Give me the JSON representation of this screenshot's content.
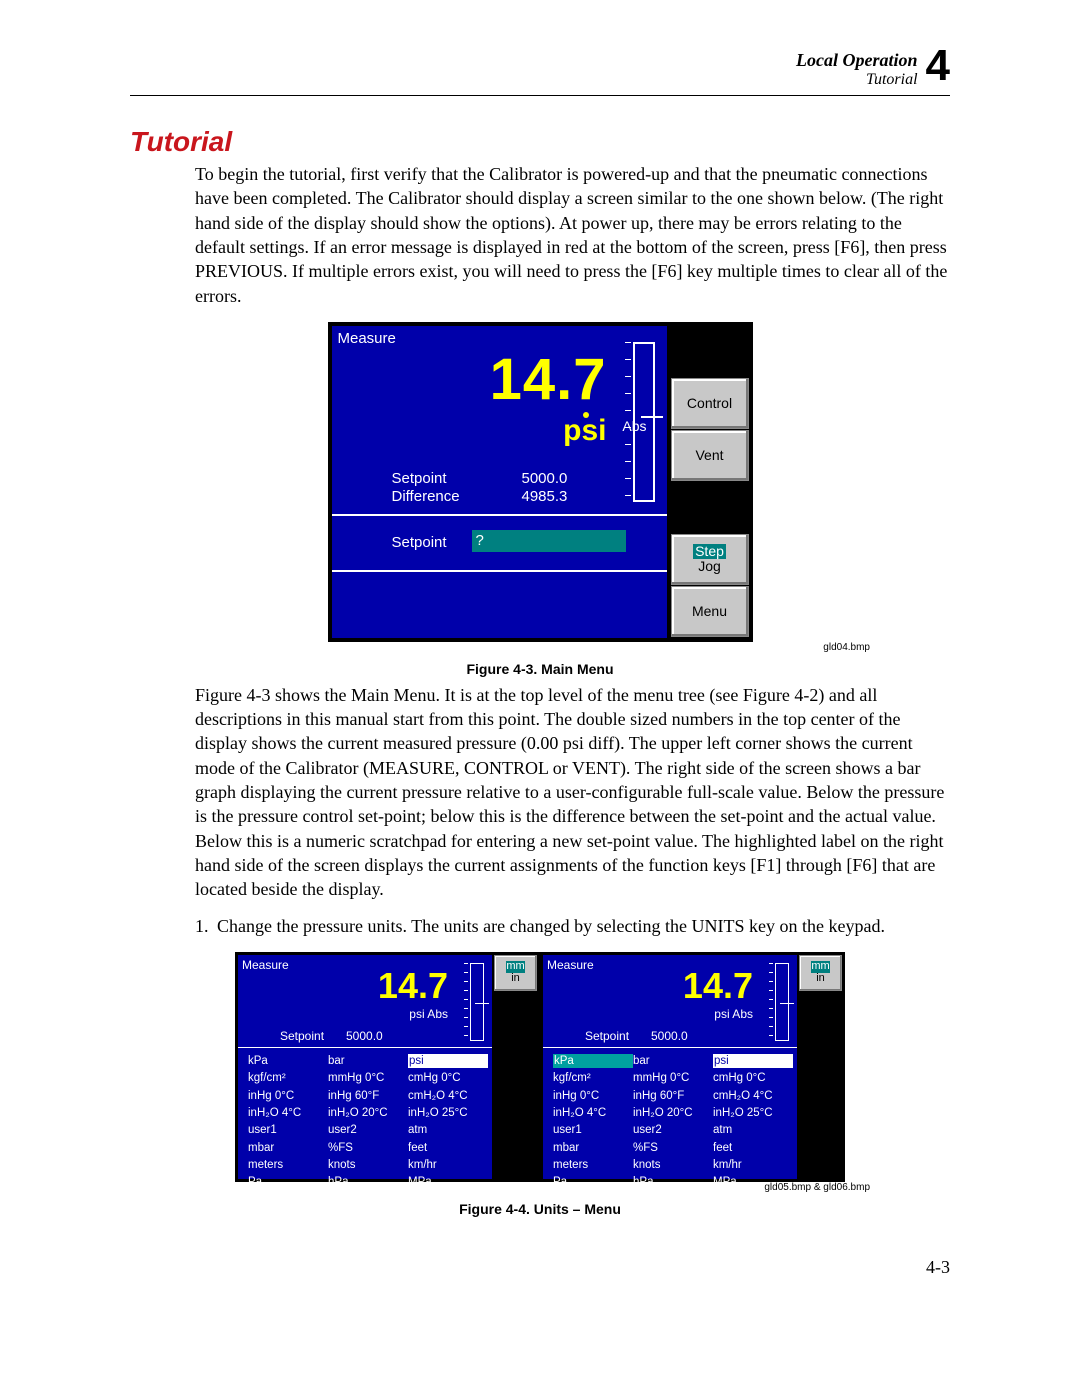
{
  "header": {
    "title": "Local Operation",
    "subtitle": "Tutorial",
    "chapter": "4"
  },
  "section_heading": "Tutorial",
  "para1": "To begin the tutorial, first verify that the Calibrator is powered-up and that the pneumatic connections have been completed. The Calibrator should display a screen similar to the one shown below. (The right hand side of the display should show the options). At power up, there may be errors relating to the default settings. If an error message is displayed in red at the bottom of the screen, press [F6], then press PREVIOUS. If multiple errors exist, you will need to press the [F6] key multiple times to clear all of the errors.",
  "fig43": {
    "mode": "Measure",
    "reading": "14.7",
    "unit": "psi",
    "abs": "Abs",
    "setpoint_label": "Setpoint",
    "difference_label": "Difference",
    "setpoint_value": "5000.0",
    "difference_value": "4985.3",
    "scratch_label": "Setpoint",
    "scratch_value": "?",
    "buttons": {
      "f2": "Control",
      "f3": "Vent",
      "f5_hi": "Step",
      "f5_lo": "Jog",
      "f6": "Menu"
    },
    "caption": "Figure 4-3. Main Menu",
    "imgid": "gld04.bmp"
  },
  "para2": "Figure 4-3 shows the Main Menu. It is at the top level of the menu tree (see Figure 4-2) and all descriptions in this manual start from this point. The double sized numbers in the top center of the display shows the current measured pressure (0.00 psi diff). The upper left corner shows the current mode of the Calibrator (MEASURE, CONTROL or VENT). The right side of the screen shows a bar graph displaying the current pressure relative to a user-configurable full-scale value. Below the pressure is the pressure control set-point; below this is the difference between the set-point and the actual value. Below this is a numeric scratchpad for entering a new set-point value. The highlighted label on the right hand side of the screen displays the current assignments of the function keys [F1] through [F6] that are located beside the display.",
  "step1": "Change the pressure units. The units are changed by selecting the UNITS key on the keypad.",
  "fig44": {
    "mode": "Measure",
    "reading": "14.7",
    "unit": "psi Abs",
    "setpoint_label": "Setpoint",
    "setpoint_value": "5000.0",
    "btn_top_hi": "mm",
    "btn_top_lo": "in",
    "units_col1": [
      "kPa",
      "kgf/cm²",
      "inHg 0°C",
      "inH₂O 4°C",
      "user1",
      "mbar",
      "meters",
      "Pa"
    ],
    "units_col2": [
      "bar",
      "mmHg 0°C",
      "inHg 60°F",
      "inH₂O 20°C",
      "user2",
      "%FS",
      "knots",
      "hPa"
    ],
    "units_col3": [
      "psi",
      "cmHg 0°C",
      "cmH₂O 4°C",
      "inH₂O 25°C",
      "atm",
      "feet",
      "km/hr",
      "MPa"
    ],
    "left_selected": "psi",
    "right_selected_a": "kPa",
    "right_selected_b": "psi",
    "caption": "Figure 4-4. Units – Menu",
    "imgid": "gld05.bmp & gld06.bmp"
  },
  "page_number": "4-3"
}
